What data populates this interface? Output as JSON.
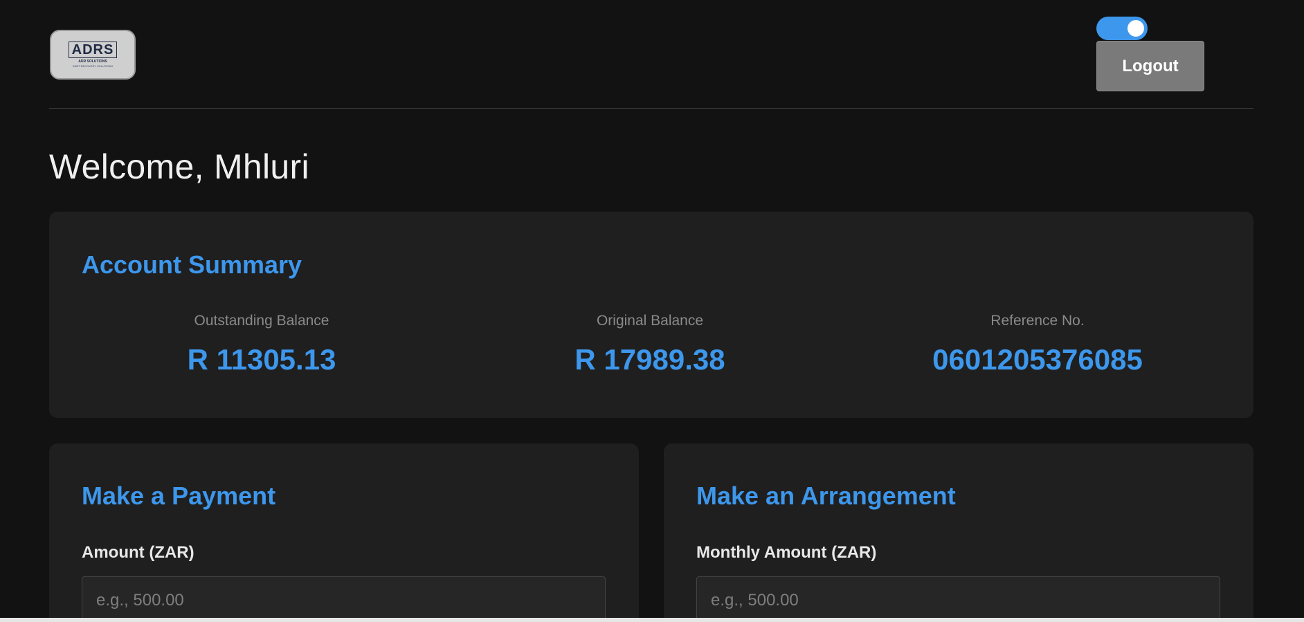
{
  "header": {
    "logo": {
      "text": "ADRS",
      "sub": "ADR SOLUTIONS",
      "tagline": "DEBT RECOVERY SOLUTIONS"
    },
    "theme_toggle": {
      "state": "on",
      "color": "#3d97ec"
    },
    "logout_label": "Logout"
  },
  "welcome": "Welcome, Mhluri",
  "summary": {
    "title": "Account Summary",
    "stats": [
      {
        "label": "Outstanding Balance",
        "value": "R 11305.13"
      },
      {
        "label": "Original Balance",
        "value": "R 17989.38"
      },
      {
        "label": "Reference No.",
        "value": "0601205376085"
      }
    ]
  },
  "payment": {
    "title": "Make a Payment",
    "field_label": "Amount (ZAR)",
    "placeholder": "e.g., 500.00",
    "value": ""
  },
  "arrangement": {
    "title": "Make an Arrangement",
    "field_label": "Monthly Amount (ZAR)",
    "placeholder": "e.g., 500.00",
    "value": ""
  },
  "colors": {
    "accent": "#3d97ec",
    "background": "#121212",
    "card": "#1f1f1f"
  }
}
